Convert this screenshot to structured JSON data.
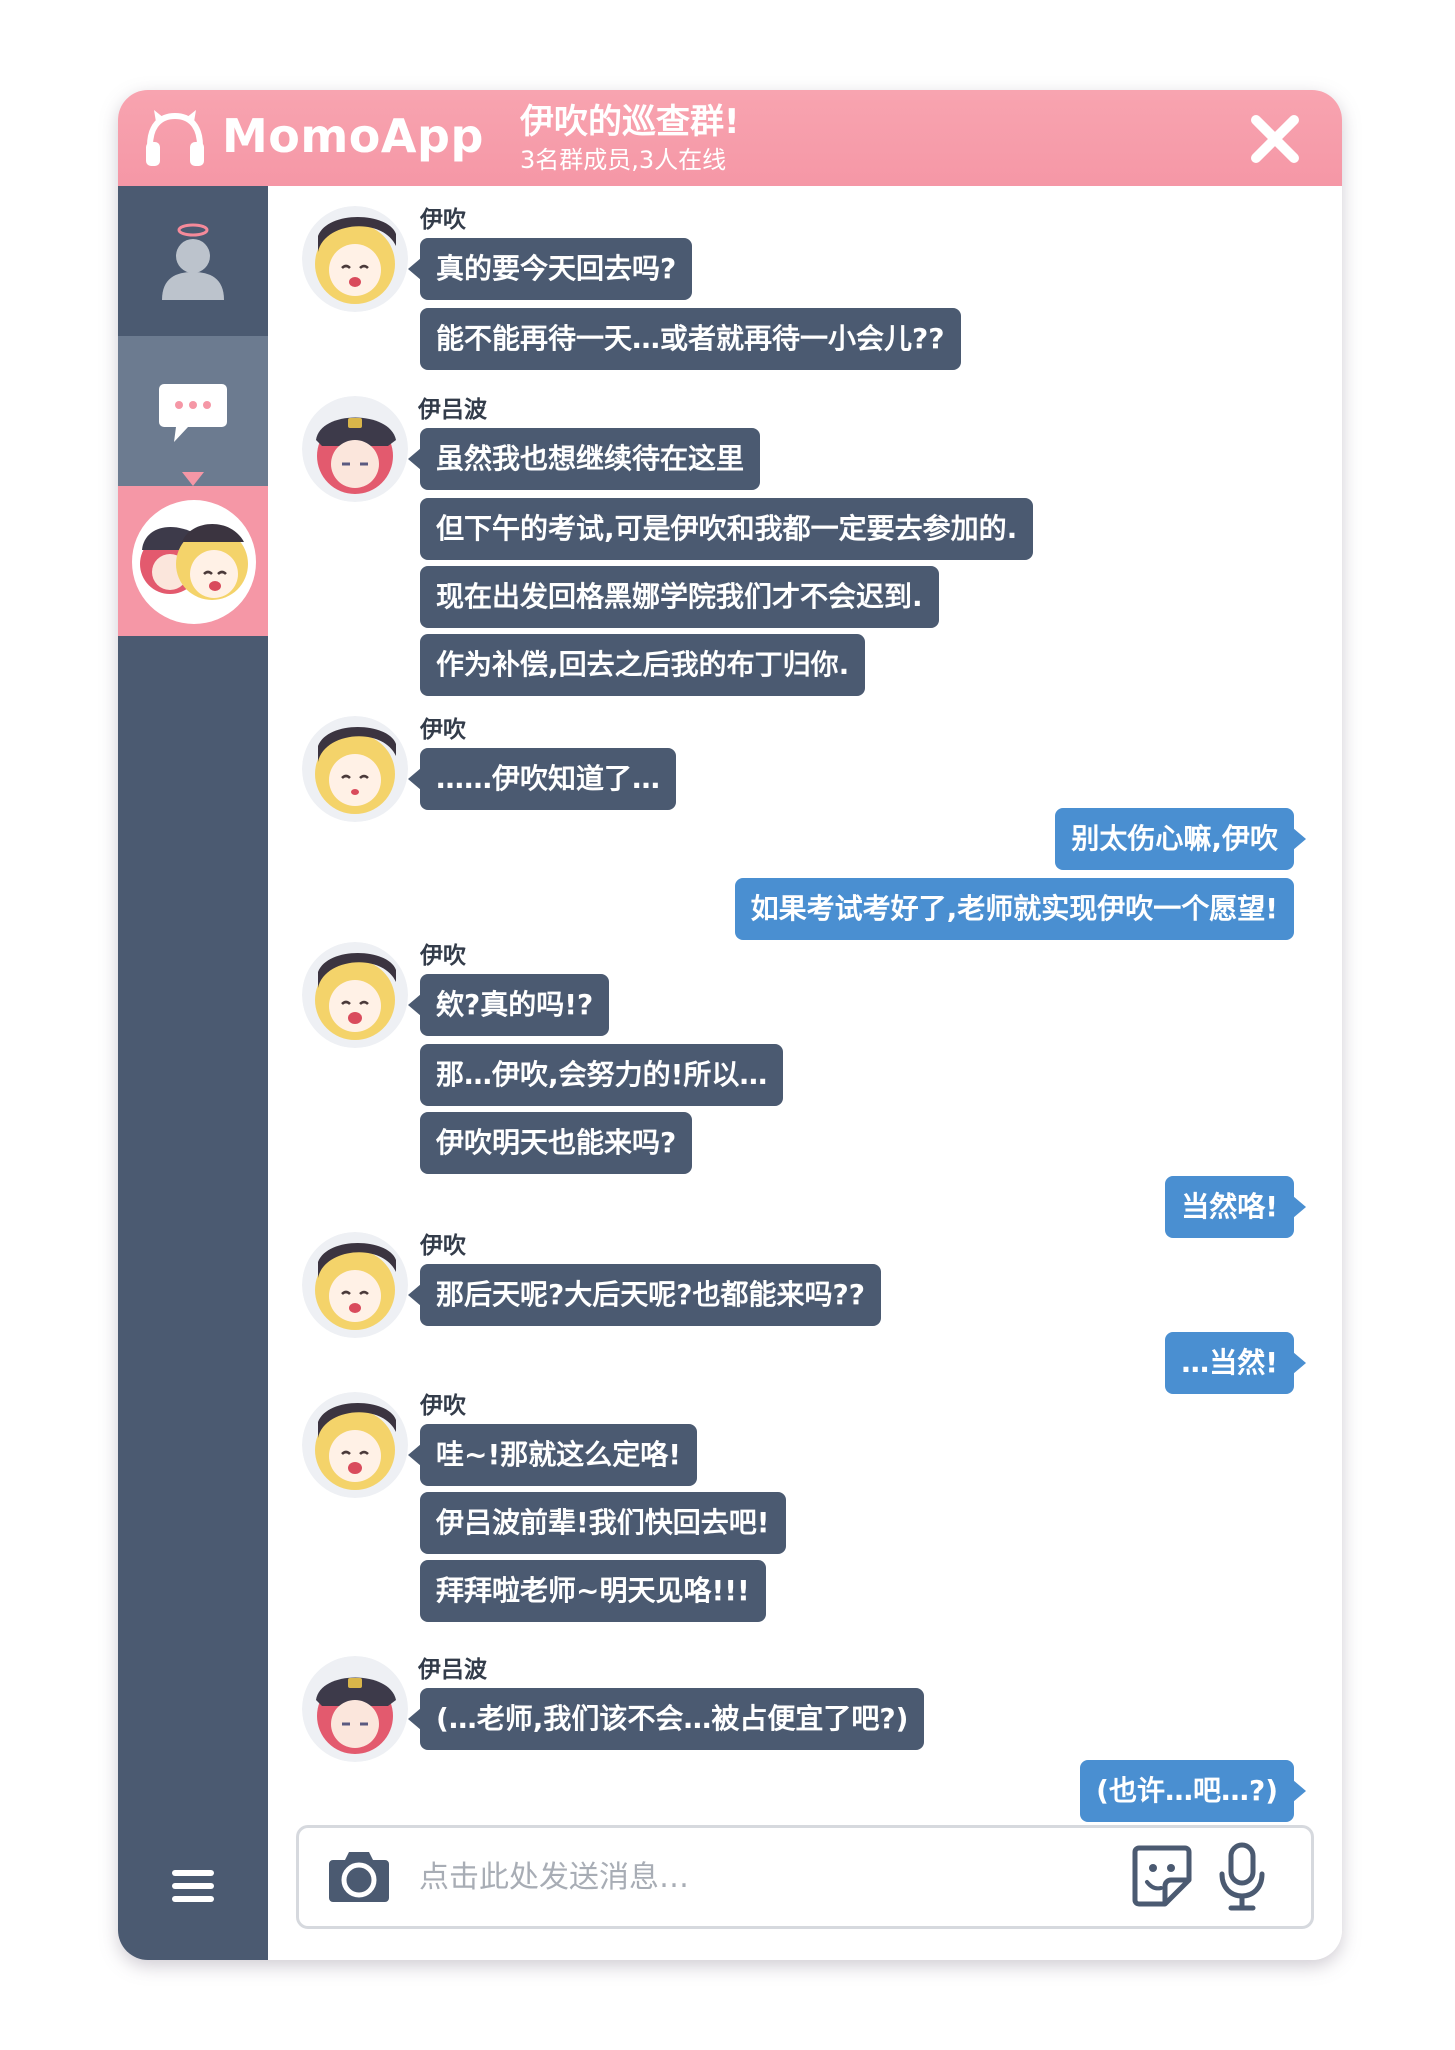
{
  "header": {
    "app_name": "MomoApp",
    "group_title": "伊吹的巡查群!",
    "group_subtitle": "3名群成员,3人在线"
  },
  "sidebar": {
    "items": [
      "profile",
      "chat",
      "group",
      "menu"
    ]
  },
  "messages": [
    {
      "id": "m1",
      "sender": "伊吹",
      "side": "left",
      "lines": [
        "真的要今天回去吗?",
        "能不能再待一天…或者就再待一小会儿??"
      ]
    },
    {
      "id": "m2",
      "sender": "伊吕波",
      "side": "left",
      "lines": [
        "虽然我也想继续待在这里",
        "但下午的考试,可是伊吹和我都一定要去参加的.",
        "现在出发回格黑娜学院我们才不会迟到.",
        "作为补偿,回去之后我的布丁归你."
      ]
    },
    {
      "id": "m3",
      "sender": "伊吹",
      "side": "left",
      "lines": [
        "……伊吹知道了…"
      ]
    },
    {
      "id": "m4",
      "sender": "",
      "side": "right",
      "lines": [
        "别太伤心嘛,伊吹",
        "如果考试考好了,老师就实现伊吹一个愿望!"
      ]
    },
    {
      "id": "m5",
      "sender": "伊吹",
      "side": "left",
      "lines": [
        "欸?真的吗!?",
        "那…伊吹,会努力的!所以…",
        "伊吹明天也能来吗?"
      ]
    },
    {
      "id": "m6",
      "sender": "",
      "side": "right",
      "lines": [
        "当然咯!"
      ]
    },
    {
      "id": "m7",
      "sender": "伊吹",
      "side": "left",
      "lines": [
        "那后天呢?大后天呢?也都能来吗??"
      ]
    },
    {
      "id": "m8",
      "sender": "",
      "side": "right",
      "lines": [
        "…当然!"
      ]
    },
    {
      "id": "m9",
      "sender": "伊吹",
      "side": "left",
      "lines": [
        "哇~!那就这么定咯!",
        "伊吕波前辈!我们快回去吧!",
        "拜拜啦老师~明天见咯!!!"
      ]
    },
    {
      "id": "m10",
      "sender": "伊吕波",
      "side": "left",
      "lines": [
        "(…老师,我们该不会…被占便宜了吧?)"
      ]
    },
    {
      "id": "m11",
      "sender": "",
      "side": "right",
      "lines": [
        "(也许…吧…?)"
      ]
    }
  ],
  "input": {
    "placeholder": "点击此处发送消息…"
  },
  "colors": {
    "header": "#f597a6",
    "sidebar": "#4b5a71",
    "bubble_left": "#4b5a71",
    "bubble_right": "#4a8fd1"
  },
  "icons": {
    "close": "close-icon",
    "camera": "camera-icon",
    "sticker": "sticker-icon",
    "mic": "microphone-icon",
    "menu": "menu-icon"
  }
}
